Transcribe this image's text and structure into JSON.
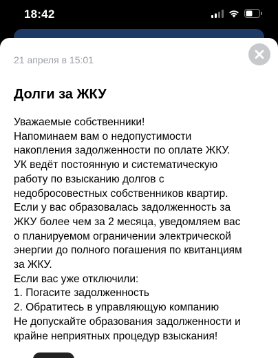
{
  "status_bar": {
    "time": "18:42",
    "icons": [
      "signal-icon",
      "wifi-icon",
      "battery-icon"
    ]
  },
  "sheet": {
    "date": "21 апреля в 15:01",
    "close_icon": "close-icon",
    "title": "Долги за ЖКУ",
    "body_lines": [
      "Уважаемые собственники!",
      "Напоминаем вам о недопустимости",
      "накопления задолженности по оплате ЖКУ.",
      "УК ведёт постоянную и систематическую",
      "работу по взысканию долгов с",
      "недобросовестных собственников квартир.",
      "Если у вас образовалась задолженность за",
      "ЖКУ более чем за 2 месяца, уведомляем вас",
      "о планируемом ограничении электрической",
      "энергии до полного погашения по квитанциям",
      "за ЖКУ.",
      "Если вас уже отключили:",
      "1. Погасите задолженность",
      "2. Обратитесь в управляющую компанию",
      "Не допускайте образования задолженности и",
      "крайне неприятных процедур взыскания!"
    ]
  },
  "colors": {
    "background": "#000000",
    "sheet": "#ffffff",
    "underlay": "#1d3a66",
    "date_text": "#9b9ea3",
    "close_button": "#c8c9cc"
  }
}
